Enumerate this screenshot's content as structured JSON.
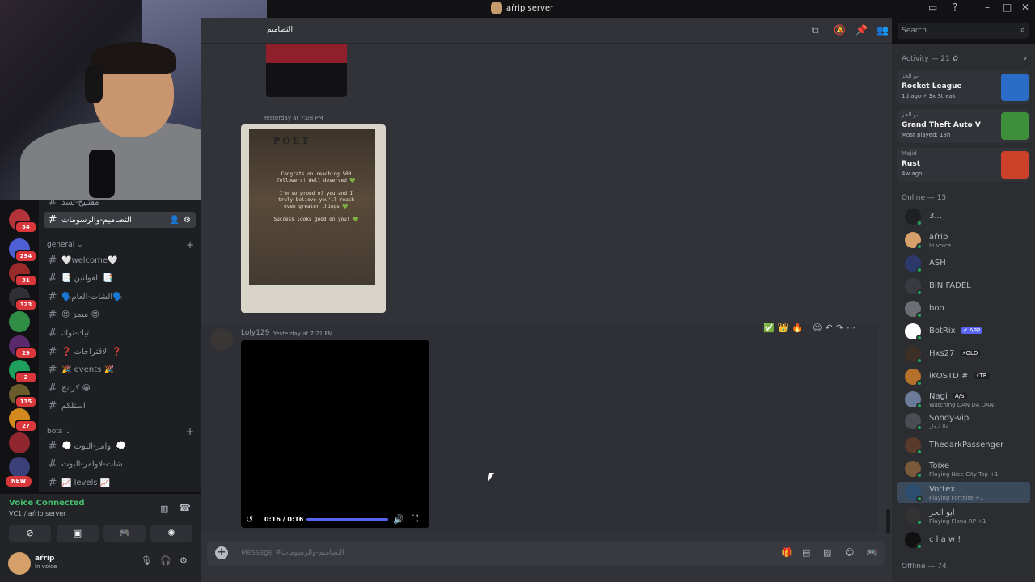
{
  "window": {
    "title": "aŕrip server"
  },
  "guilds": [
    {
      "badge": "34",
      "color": "#b3343a"
    },
    {
      "badge": "294",
      "color": "#4e5fd6"
    },
    {
      "badge": "31",
      "color": "#9a2a2a"
    },
    {
      "badge": "323",
      "color": "#2f2f35"
    },
    {
      "badge": "",
      "color": "#2f8d45"
    },
    {
      "badge": "29",
      "color": "#5a2a6c"
    },
    {
      "badge": "2",
      "color": "#1f9f5c"
    },
    {
      "badge": "135",
      "color": "#6b5a2a"
    },
    {
      "badge": "27",
      "color": "#d28a1f"
    },
    {
      "badge": "",
      "color": "#8f2630"
    },
    {
      "badge": "",
      "color": "#3b3f7a"
    }
  ],
  "guild_new_label": "NEW",
  "channels": {
    "top_partial": "مقتنيح-تسد",
    "active": "التصاميم-والرسومات",
    "categories": {
      "general": "general",
      "bots": "bots"
    },
    "general": [
      "🤍welcome🤍",
      "📑 القوانين 📑",
      "🗣️الشات-العام🗣️",
      "😍 ميمز 😍",
      "تيك-توك",
      "❓ الاقتراحات ❓",
      "🎉 events 🎉",
      "كرانج 😁",
      "استلكم"
    ],
    "bots": [
      "💭 اوامر-البوت 💭",
      "شات-لاوامر-البوت",
      "📈 levels 📈"
    ]
  },
  "voice": {
    "status": "Voice Connected",
    "sub": "VC1 / aŕrip server"
  },
  "user": {
    "name": "aŕrip",
    "status": "In voice"
  },
  "header": {
    "channel": "التصاميم"
  },
  "messages": {
    "image_time": "Yesterday at 7:08 PM",
    "poster_title": "POET",
    "poster_lines": [
      "Congrats on reaching 500 followers! Well deserved 💚",
      "I'm so proud of you and I truly believe you'll reach even greater things 💚",
      "Success looks good on you! 💚"
    ],
    "video_author": "Loly129",
    "video_time": "Yesterday at 7:21 PM",
    "video_timecode": "0:16 / 0:16",
    "video_progress": 1.0
  },
  "reactions": [
    "✅",
    "👑",
    "🔥"
  ],
  "composer": {
    "placeholder": "Message #التصاميم-والرسومات"
  },
  "search": {
    "placeholder": "Search"
  },
  "members": {
    "activity_header": "Activity — 21",
    "activities": [
      {
        "user": "ابو الحز",
        "game": "Rocket League",
        "meta": "1d ago  ⚡ 3x Streak",
        "color": "#2a6dc9"
      },
      {
        "user": "ابو الحز",
        "game": "Grand Theft Auto V",
        "meta": "Most played: 18h",
        "color": "#3d8f3a"
      },
      {
        "user": "Majid",
        "game": "Rust",
        "meta": "4w ago",
        "color": "#cd412b"
      }
    ],
    "online_header": "Online — 15",
    "online": [
      {
        "name": "3...",
        "status": "",
        "color": "#1e1f22"
      },
      {
        "name": "aŕrip",
        "status": "In voice",
        "color": "#d6a06a"
      },
      {
        "name": "ASH",
        "status": "",
        "color": "#2b3a6b"
      },
      {
        "name": "BIN FADEL",
        "status": "",
        "color": "#3a3b40"
      },
      {
        "name": "boo",
        "status": "",
        "color": "#6d6e73"
      },
      {
        "name": "BotRix",
        "status": "",
        "tag": "✔ APP",
        "color": "#ffffff"
      },
      {
        "name": "Hxs27",
        "status": "",
        "tag": "⚡OLD",
        "color": "#3c3026"
      },
      {
        "name": "iKOSTD #",
        "status": "",
        "tag": "⚡TR",
        "color": "#b5712a"
      },
      {
        "name": "Nagi",
        "status": "Watching DAN DA DAN",
        "tag": "A/S",
        "color": "#6a7c9a"
      },
      {
        "name": "Sondy-vip",
        "status": "عاا لبجل",
        "color": "#4c4d52"
      },
      {
        "name": "ThedarkPassenger",
        "status": "",
        "color": "#5a3a2a"
      },
      {
        "name": "Toixe",
        "status": "Playing Nice City Top +1",
        "color": "#7a5a3a"
      },
      {
        "name": "Vortex",
        "status": "Playing Fortnite +1",
        "color": "#2d4e6e"
      },
      {
        "name": "ابو الحز",
        "status": "Playing Flona RP +1",
        "color": "#333"
      },
      {
        "name": "c l a w !",
        "status": "",
        "color": "#111"
      }
    ],
    "offline_header": "Offline — 74"
  }
}
